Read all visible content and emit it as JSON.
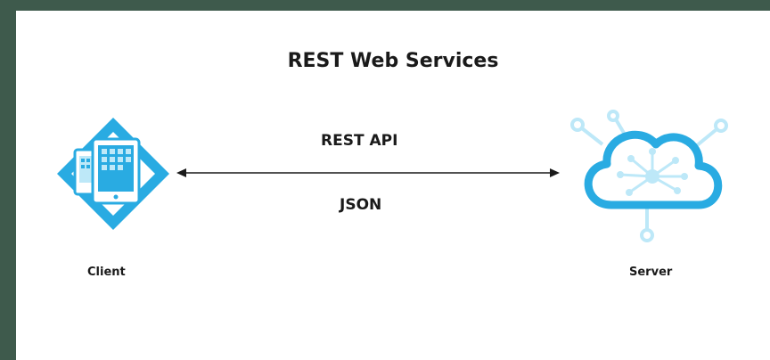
{
  "diagram": {
    "title": "REST Web Services",
    "connection": {
      "top_label": "REST API",
      "bottom_label": "JSON"
    },
    "nodes": {
      "client": {
        "label": "Client",
        "icon": "client-devices-icon"
      },
      "server": {
        "label": "Server",
        "icon": "cloud-network-icon"
      }
    },
    "colors": {
      "accent": "#29abe2",
      "accent_light": "#bde8f8",
      "text": "#1a1a1a"
    }
  }
}
